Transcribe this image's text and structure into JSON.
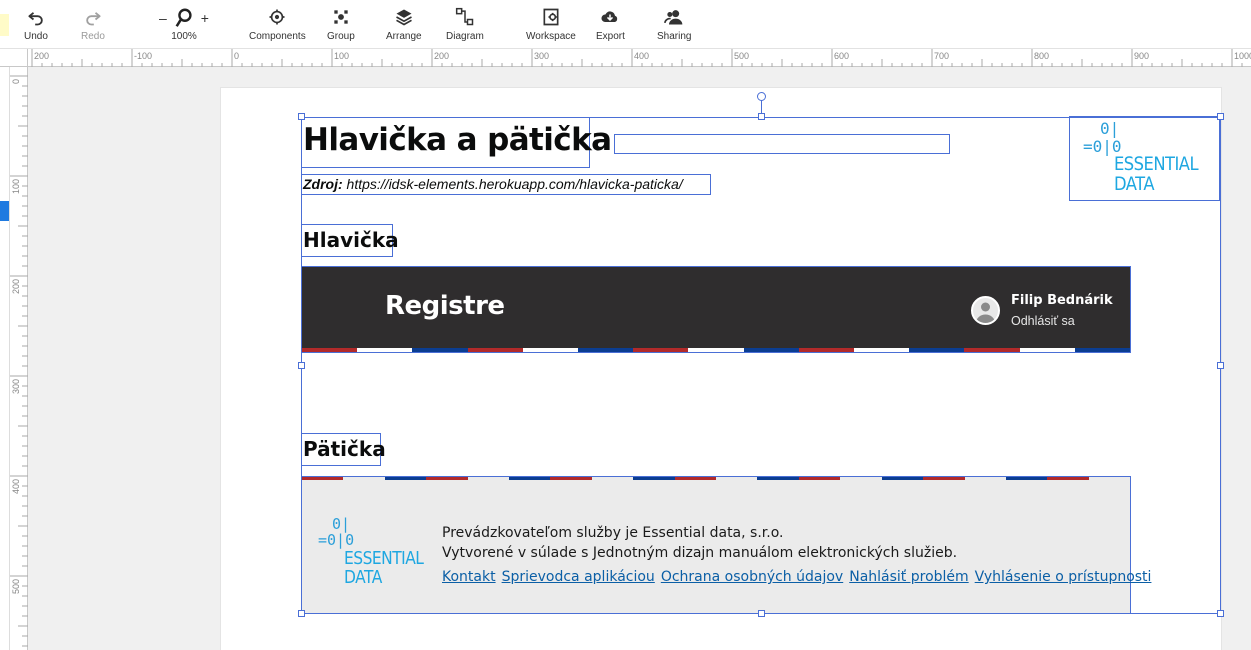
{
  "toolbar": {
    "undo": "Undo",
    "redo": "Redo",
    "zoom_minus": "–",
    "zoom_plus": "+",
    "zoom_level": "100%",
    "components": "Components",
    "group": "Group",
    "arrange": "Arrange",
    "diagram": "Diagram",
    "workspace": "Workspace",
    "export": "Export",
    "sharing": "Sharing"
  },
  "rulers": {
    "top_ticks": [
      "200",
      "-100",
      "0",
      "100",
      "200",
      "300",
      "400",
      "500",
      "600",
      "700",
      "800",
      "900",
      "1000"
    ],
    "left_ticks": [
      "0",
      "100",
      "200",
      "300",
      "400",
      "500"
    ]
  },
  "page": {
    "title": "Hlavička a pätička",
    "source_label": "Zdroj:",
    "source_url": "https://idsk-elements.herokuapp.com/hlavicka-paticka/",
    "logo": {
      "bits_top": "0|",
      "bits_bottom": "=0|0",
      "line1": "ESSENTIAL",
      "line2": "DATA"
    },
    "header_section_title": "Hlavička",
    "header_bar": {
      "title": "Registre",
      "user_name": "Filip Bednárik",
      "logout": "Odhlásiť sa"
    },
    "footer_section_title": "Pätička",
    "footer": {
      "line1": "Prevádzkovateľom služby je Essential data, s.r.o.",
      "line2": "Vytvorené v súlade s Jednotným dizajn manuálom elektronických služieb.",
      "links": [
        "Kontakt",
        "Sprievodca aplikáciou",
        "Ochrana osobných údajov",
        "Nahlásiť problém",
        "Vyhlásenie o prístupnosti"
      ]
    }
  },
  "colors": {
    "selection": "#4a6fd6",
    "header_bg": "#2f2d2e",
    "stripe_red": "#b22a2a",
    "stripe_blue": "#0b3d91",
    "logo_blue": "#1ea7e1",
    "footer_bg": "#ebebeb",
    "link": "#0b5fa6"
  }
}
